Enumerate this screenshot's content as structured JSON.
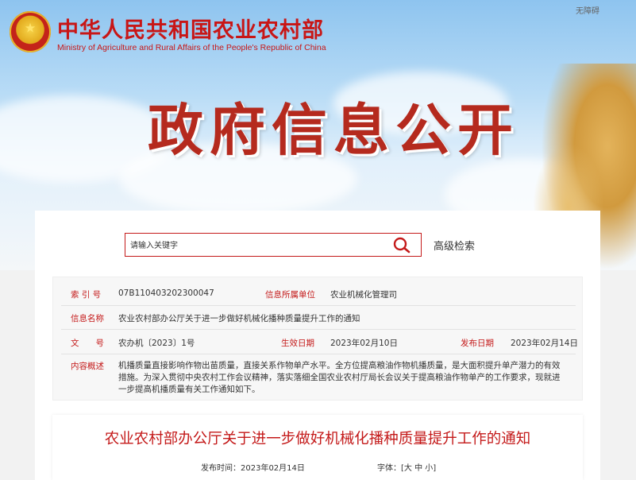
{
  "header": {
    "ministry_cn": "中华人民共和国农业农村部",
    "ministry_en": "Ministry of Agriculture and Rural Affairs of the People's Republic of China",
    "accessibility_label": "无障碍",
    "page_title": "政府信息公开",
    "emblem_icon": "national-emblem-icon"
  },
  "search": {
    "placeholder": "请输入关键字",
    "value": "",
    "search_icon": "search-icon",
    "advanced_label": "高级检索"
  },
  "info": {
    "index_label": "索 引 号",
    "index_value": "07B110403202300047",
    "org_label": "信息所属单位",
    "org_value": "农业机械化管理司",
    "name_label": "信息名称",
    "name_value": "农业农村部办公厅关于进一步做好机械化播种质量提升工作的通知",
    "doc_label": "文　　号",
    "doc_value": "农办机〔2023〕1号",
    "effective_label": "生效日期",
    "effective_value": "2023年02月10日",
    "issued_label": "发布日期",
    "issued_value": "2023年02月14日",
    "summary_label": "内容概述",
    "summary_value": "机播质量直接影响作物出苗质量，直接关系作物单产水平。全方位提高粮油作物机播质量，是大面积提升单产潜力的有效措施。为深入贯彻中央农村工作会议精神，落实落细全国农业农村厅局长会议关于提高粮油作物单产的工作要求，现就进一步提高机播质量有关工作通知如下。"
  },
  "article": {
    "title": "农业农村部办公厅关于进一步做好机械化播种质量提升工作的通知",
    "publish_label": "发布时间：",
    "publish_value": "2023年02月14日",
    "font_label": "字体：",
    "font_open": "[",
    "font_large": "大",
    "font_medium": "中",
    "font_small": "小",
    "font_close": "]"
  },
  "colors": {
    "brand_red": "#c41a1a",
    "title_red": "#b52a1e"
  }
}
